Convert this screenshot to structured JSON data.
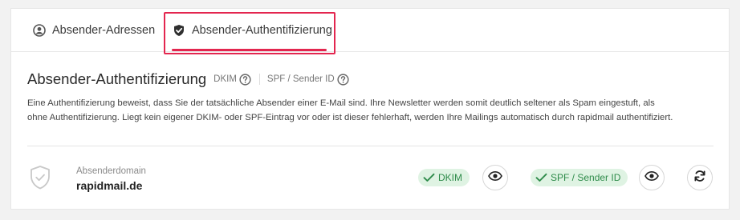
{
  "tabs": [
    {
      "label": "Absender-Adressen",
      "icon": "user-circle-icon",
      "active": false
    },
    {
      "label": "Absender-Authentifizierung",
      "icon": "shield-check-icon",
      "active": true
    }
  ],
  "colors": {
    "accent": "#e3264f",
    "success_bg": "#dff3e3",
    "success_text": "#2e8b4a"
  },
  "section": {
    "title": "Absender-Authentifizierung",
    "dkim_hint": "DKIM",
    "spf_hint": "SPF / Sender ID",
    "description_line1": "Eine Authentifizierung beweist, dass Sie der tatsächliche Absender einer E-Mail sind. Ihre Newsletter werden somit deutlich seltener als Spam eingestuft, als",
    "description_line2": "ohne Authentifizierung. Liegt kein eigener DKIM- oder SPF-Eintrag vor oder ist dieser fehlerhaft, werden Ihre Mailings automatisch durch rapidmail authentifiziert."
  },
  "domain_row": {
    "label": "Absenderdomain",
    "value": "rapidmail.de",
    "dkim_status": "DKIM",
    "spf_status": "SPF / Sender ID"
  }
}
